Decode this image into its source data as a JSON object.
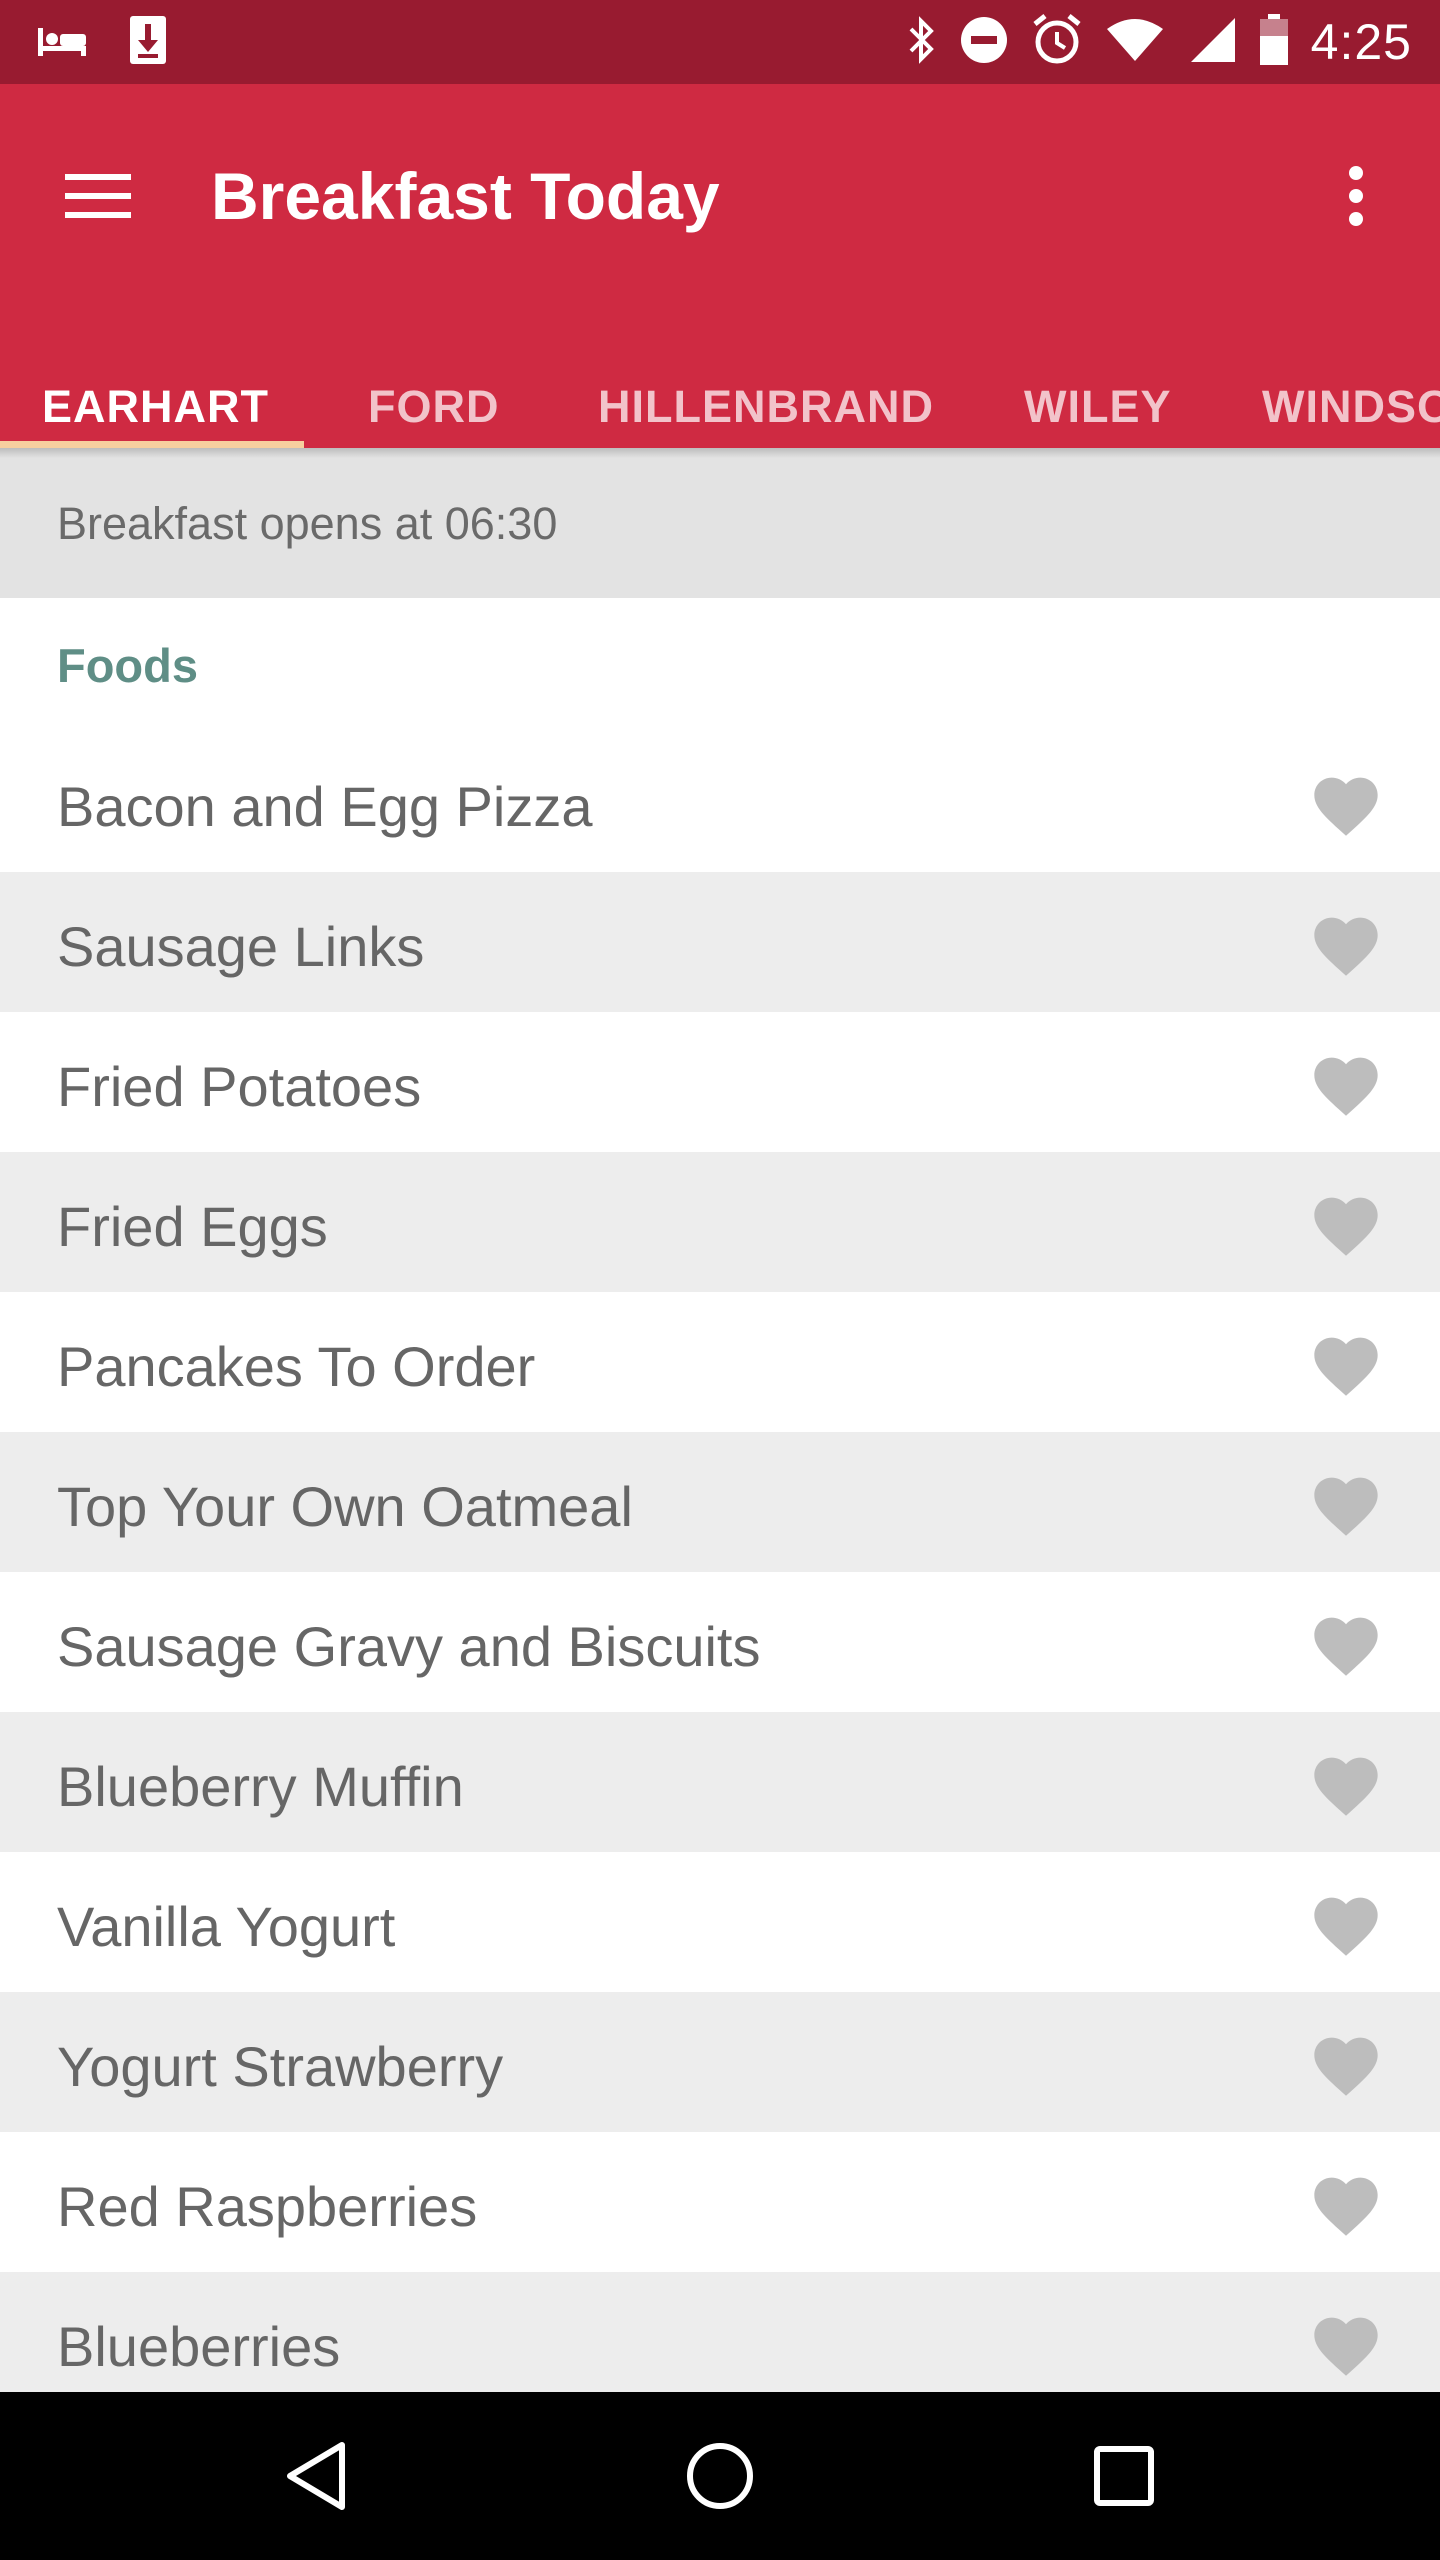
{
  "status_bar": {
    "time": "4:25",
    "icons": [
      "sleep-icon",
      "download-icon",
      "bluetooth-icon",
      "do-not-disturb-icon",
      "alarm-icon",
      "wifi-icon",
      "cell-signal-icon",
      "battery-icon"
    ]
  },
  "app_bar": {
    "title": "Breakfast Today",
    "menu_icon": "hamburger-menu-icon",
    "overflow_icon": "more-vertical-icon",
    "color": "#cf2a42"
  },
  "tabs": [
    {
      "label": "EARHART",
      "active": true
    },
    {
      "label": "FORD",
      "active": false
    },
    {
      "label": "HILLENBRAND",
      "active": false
    },
    {
      "label": "WILEY",
      "active": false
    },
    {
      "label": "WINDSOR",
      "active": false
    }
  ],
  "notice": "Breakfast opens at 06:30",
  "section": {
    "title": "Foods"
  },
  "items": [
    {
      "name": "Bacon and Egg Pizza",
      "favorite": false
    },
    {
      "name": "Sausage Links",
      "favorite": false
    },
    {
      "name": "Fried Potatoes",
      "favorite": false
    },
    {
      "name": "Fried Eggs",
      "favorite": false
    },
    {
      "name": "Pancakes To Order",
      "favorite": false
    },
    {
      "name": "Top Your Own Oatmeal",
      "favorite": false
    },
    {
      "name": "Sausage Gravy and Biscuits",
      "favorite": false
    },
    {
      "name": "Blueberry Muffin",
      "favorite": false
    },
    {
      "name": "Vanilla Yogurt",
      "favorite": false
    },
    {
      "name": "Yogurt Strawberry",
      "favorite": false
    },
    {
      "name": "Red Raspberries",
      "favorite": false
    },
    {
      "name": "Blueberries",
      "favorite": false
    }
  ],
  "nav_bar": {
    "back_icon": "back-triangle-icon",
    "home_icon": "home-circle-icon",
    "recents_icon": "recents-square-icon"
  },
  "colors": {
    "status_bar": "#981b30",
    "accent_indicator": "#f7cf9f",
    "section_header": "#5f8e86",
    "heart_inactive": "#bdbdbd"
  }
}
